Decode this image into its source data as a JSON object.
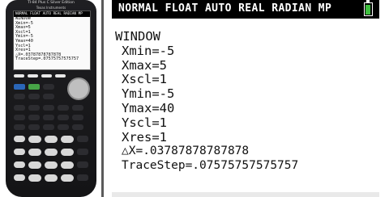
{
  "calculator": {
    "model_label": "TI-84 Plus C Silver Edition",
    "brand_label": "Texas Instruments",
    "mini_status": "NORMAL FLOAT AUTO REAL RADIAN MP",
    "mini_lines": [
      "WINDOW",
      "Xmin=-5",
      "Xmax=5",
      "Xscl=1",
      "Ymin=-5",
      "Ymax=40",
      "Yscl=1",
      "Xres=1",
      "△X=.03787878787878",
      "TraceStep=.07575757575757"
    ]
  },
  "screen": {
    "status_text": "NORMAL FLOAT AUTO REAL RADIAN MP",
    "battery_icon": "battery-icon",
    "title": "WINDOW",
    "settings": [
      {
        "label": "Xmin",
        "value": "-5",
        "text": "Xmin=-5"
      },
      {
        "label": "Xmax",
        "value": "5",
        "text": "Xmax=5"
      },
      {
        "label": "Xscl",
        "value": "1",
        "text": "Xscl=1"
      },
      {
        "label": "Ymin",
        "value": "-5",
        "text": "Ymin=-5"
      },
      {
        "label": "Ymax",
        "value": "40",
        "text": "Ymax=40"
      },
      {
        "label": "Yscl",
        "value": "1",
        "text": "Yscl=1"
      },
      {
        "label": "Xres",
        "value": "1",
        "text": "Xres=1"
      },
      {
        "label": "△X",
        "value": ".03787878787878",
        "text": "△X=.03787878787878"
      },
      {
        "label": "TraceStep",
        "value": ".07575757575757",
        "text": "TraceStep=.07575757575757"
      }
    ]
  },
  "colors": {
    "status_bar": "#000000",
    "battery_fill": "#3fbf3f",
    "screen_background": "#ffffff",
    "text": "#111111"
  }
}
